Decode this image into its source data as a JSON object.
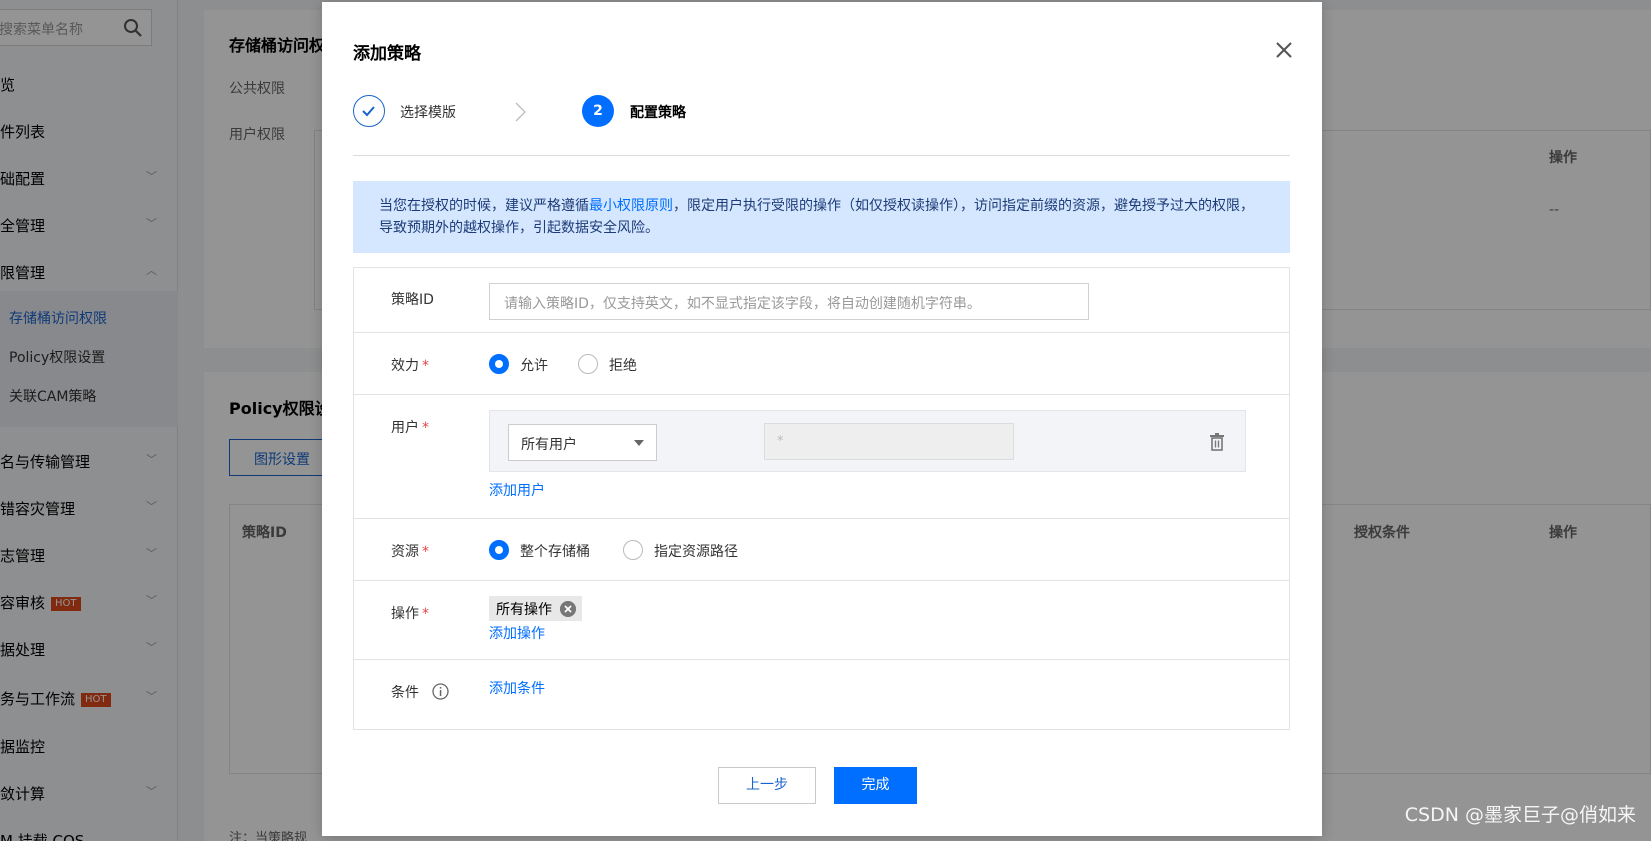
{
  "sidebar": {
    "search_placeholder": "搜索菜单名称",
    "items": [
      {
        "label": "览",
        "chevron": false
      },
      {
        "label": "件列表",
        "chevron": false
      },
      {
        "label": "础配置",
        "chevron": true
      },
      {
        "label": "全管理",
        "chevron": true
      },
      {
        "label": "限管理",
        "chevron": true
      }
    ],
    "subitems": [
      {
        "label": "存储桶访问权限",
        "active": true
      },
      {
        "label": "Policy权限设置",
        "active": false
      },
      {
        "label": "关联CAM策略",
        "active": false
      }
    ],
    "items2": [
      {
        "label": "名与传输管理",
        "hot": ""
      },
      {
        "label": "错容灾管理",
        "hot": ""
      },
      {
        "label": "志管理",
        "hot": ""
      },
      {
        "label": "容审核",
        "hot": "HOT"
      },
      {
        "label": "据处理",
        "hot": ""
      },
      {
        "label": "务与工作流",
        "hot": "HOT"
      },
      {
        "label": "据监控",
        "hot": ""
      },
      {
        "label": "敛计算",
        "hot": ""
      },
      {
        "label": "M 挂载 COS",
        "hot": ""
      }
    ]
  },
  "background": {
    "section1_title": "存储桶访问权",
    "public_perm_label": "公共权限",
    "user_perm_label": "用户权限",
    "col_operation": "操作",
    "dash": "--",
    "section2_title": "Policy权限设",
    "graphic_setting_btn": "图形设置",
    "col_policy_id": "策略ID",
    "col_auth_condition": "授权条件",
    "col_operation2": "操作",
    "footnote": "注：当策略规"
  },
  "modal": {
    "title": "添加策略",
    "steps": [
      {
        "label": "选择模版",
        "state": "done"
      },
      {
        "number": "2",
        "label": "配置策略",
        "state": "active"
      }
    ],
    "alert": {
      "prefix": "当您在授权的时候，建议严格遵循",
      "link": "最小权限原则",
      "suffix": "，限定用户执行受限的操作（如仅授权读操作），访问指定前缀的资源，避免授予过大的权限，导致预期外的越权操作，引起数据安全风险。"
    },
    "form": {
      "policy_id": {
        "label": "策略ID",
        "placeholder": "请输入策略ID，仅支持英文，如不显式指定该字段，将自动创建随机字符串。"
      },
      "effect": {
        "label": "效力",
        "required_mark": "*",
        "options": [
          "允许",
          "拒绝"
        ],
        "selected": "允许"
      },
      "user": {
        "label": "用户",
        "required_mark": "*",
        "select_value": "所有用户",
        "input_value": "*",
        "add_link": "添加用户"
      },
      "resource": {
        "label": "资源",
        "required_mark": "*",
        "options": [
          "整个存储桶",
          "指定资源路径"
        ],
        "selected": "整个存储桶"
      },
      "action": {
        "label": "操作",
        "required_mark": "*",
        "tag": "所有操作",
        "add_link": "添加操作"
      },
      "condition": {
        "label": "条件",
        "add_link": "添加条件"
      }
    },
    "buttons": {
      "prev": "上一步",
      "done": "完成"
    }
  },
  "watermark": "CSDN @墨家巨子@俏如来",
  "colors": {
    "primary": "#006eff",
    "alert_bg": "#d5e7fe",
    "required": "#e54545",
    "hot_badge": "#e0491a"
  }
}
